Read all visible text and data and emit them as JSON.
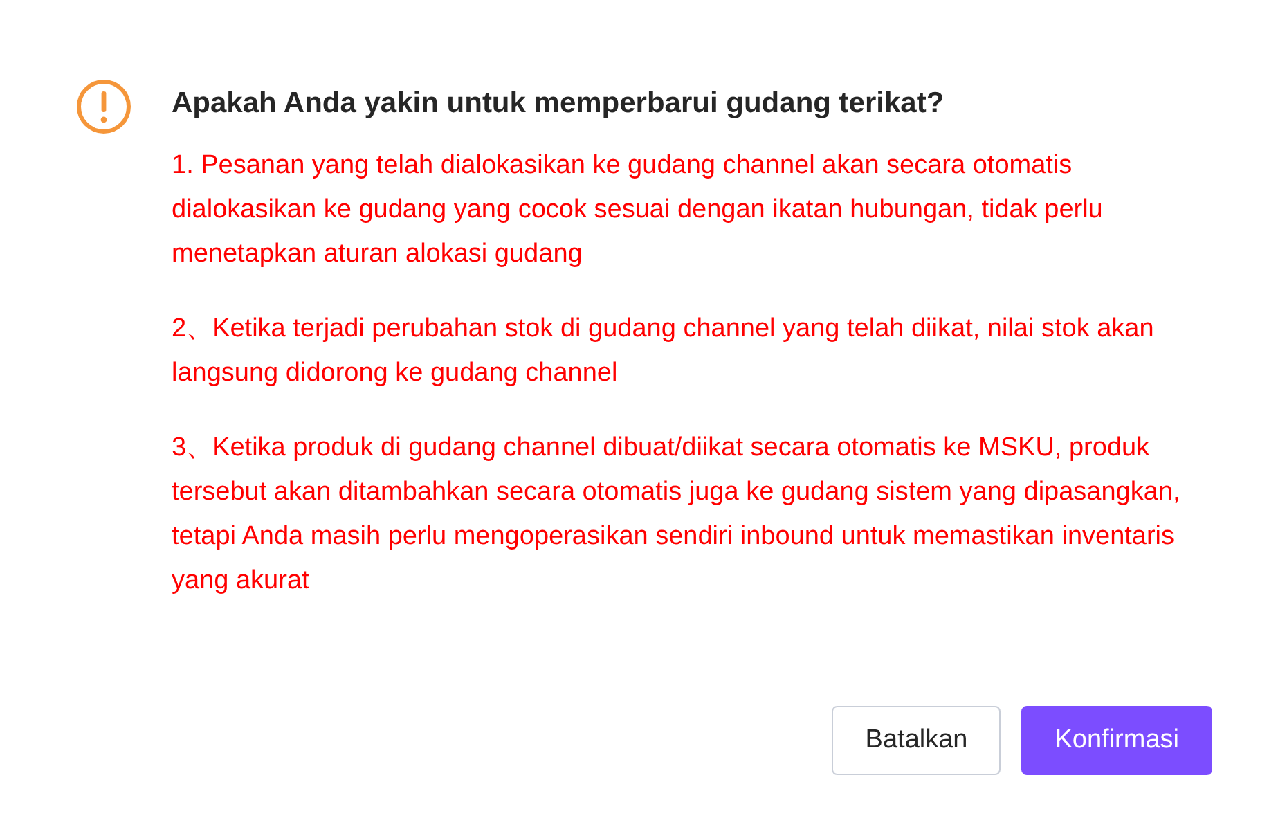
{
  "dialog": {
    "title": "Apakah Anda yakin untuk memperbarui gudang terikat?",
    "paragraphs": [
      "1. Pesanan yang telah dialokasikan ke gudang channel akan secara otomatis dialokasikan ke gudang yang cocok sesuai dengan ikatan hubungan, tidak perlu menetapkan aturan alokasi gudang",
      "2、Ketika terjadi perubahan stok di gudang channel yang telah diikat, nilai stok akan langsung didorong ke gudang channel",
      "3、Ketika produk di gudang channel dibuat/diikat secara otomatis ke MSKU, produk tersebut akan ditambahkan secara otomatis juga ke gudang sistem yang dipasangkan, tetapi Anda masih perlu mengoperasikan sendiri inbound untuk memastikan inventaris yang akurat"
    ],
    "buttons": [
      {
        "label": "Batalkan",
        "kind": "secondary"
      },
      {
        "label": "Konfirmasi",
        "kind": "primary"
      }
    ]
  }
}
